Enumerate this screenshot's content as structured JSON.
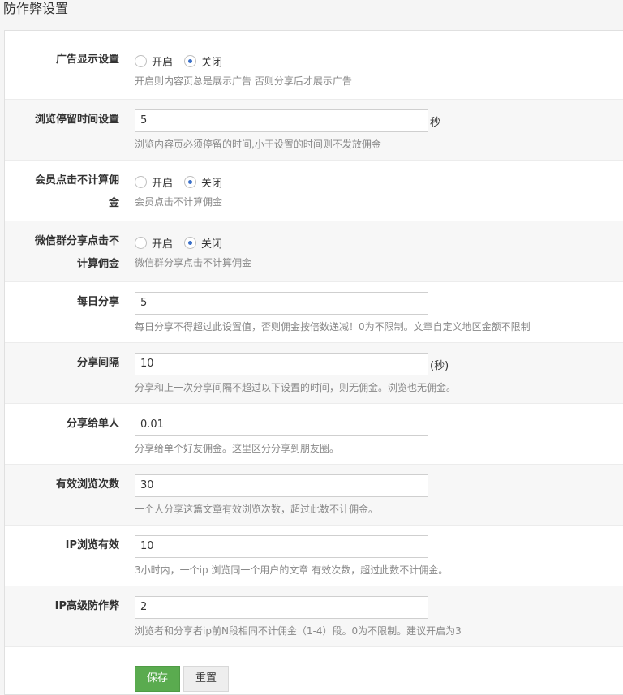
{
  "page": {
    "title": "防作弊设置"
  },
  "rows": [
    {
      "label": "广告显示设置",
      "radio": {
        "on": "开启",
        "off": "关闭",
        "selected": "off"
      },
      "help": "开启则内容页总是展示广告 否则分享后才展示广告"
    },
    {
      "label": "浏览停留时间设置",
      "value": "5",
      "suffix": "秒",
      "help": "浏览内容页必须停留的时间,小于设置的时间则不发放佣金"
    },
    {
      "label_line1": "会员点击不计算佣",
      "label_line2": "金",
      "radio": {
        "on": "开启",
        "off": "关闭",
        "selected": "off"
      },
      "help": "会员点击不计算佣金"
    },
    {
      "label_line1": "微信群分享点击不",
      "label_line2": "计算佣金",
      "radio": {
        "on": "开启",
        "off": "关闭",
        "selected": "off"
      },
      "help": "微信群分享点击不计算佣金"
    },
    {
      "label": "每日分享",
      "value": "5",
      "help": "每日分享不得超过此设置值，否则佣金按倍数递减！0为不限制。文章自定义地区金额不限制"
    },
    {
      "label": "分享间隔",
      "value": "10",
      "suffix": "(秒)",
      "help": "分享和上一次分享间隔不超过以下设置的时间，则无佣金。浏览也无佣金。"
    },
    {
      "label": "分享给单人",
      "value": "0.01",
      "help": "分享给单个好友佣金。这里区分分享到朋友圈。"
    },
    {
      "label": "有效浏览次数",
      "value": "30",
      "help": "一个人分享这篇文章有效浏览次数，超过此数不计佣金。"
    },
    {
      "label": "IP浏览有效",
      "value": "10",
      "help": "3小时内，一个ip 浏览同一个用户的文章 有效次数，超过此数不计佣金。"
    },
    {
      "label": "IP高级防作弊",
      "value": "2",
      "help": "浏览者和分享者ip前N段相同不计佣金（1-4）段。0为不限制。建议开启为3"
    }
  ],
  "actions": {
    "save": "保存",
    "reset": "重置"
  },
  "colors": {
    "save_button": "#5aab4f",
    "radio_selected": "#3a6fc8"
  }
}
